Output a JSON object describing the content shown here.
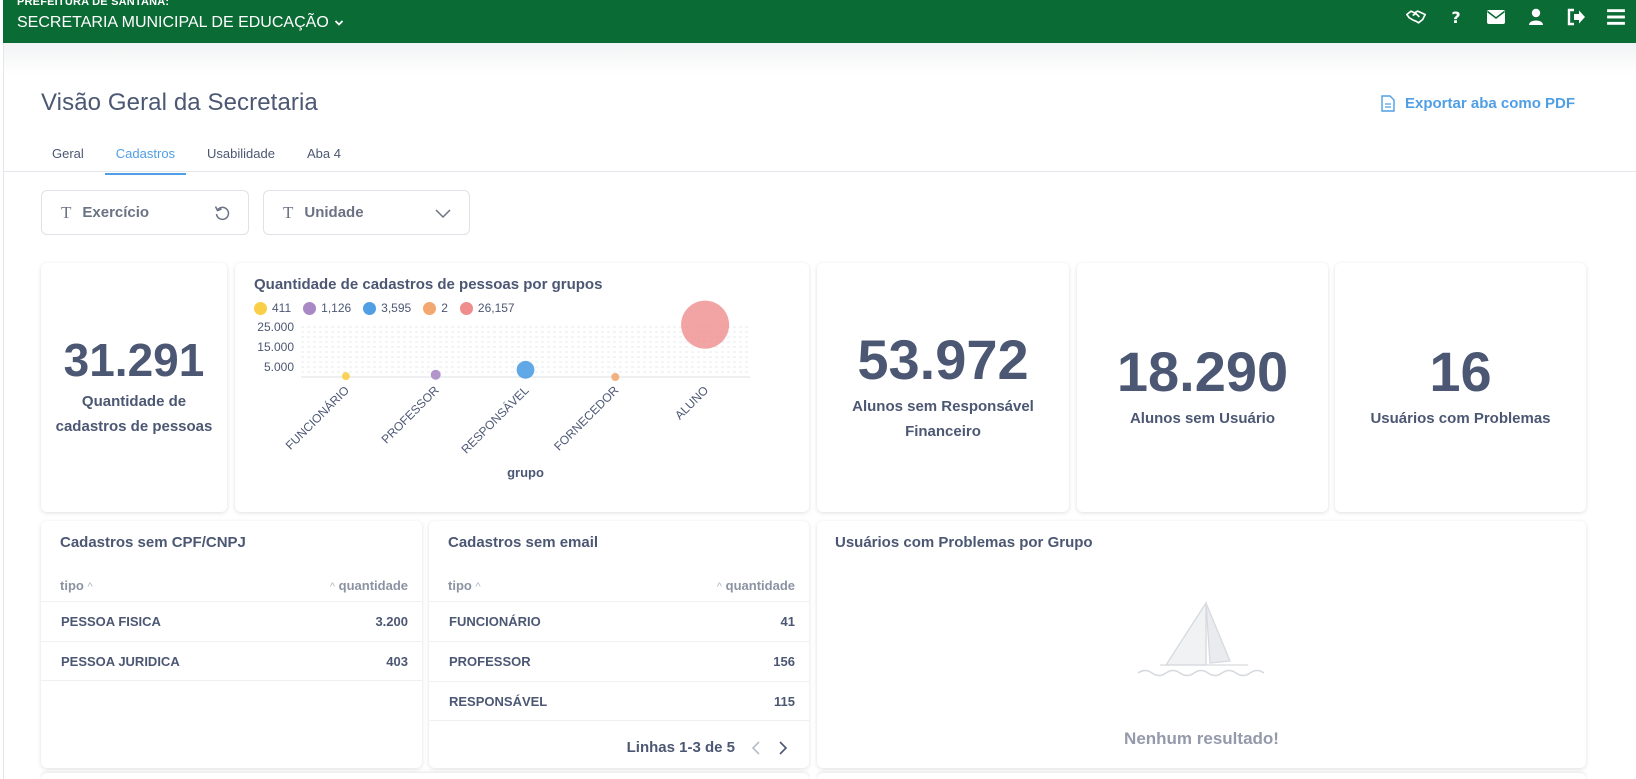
{
  "header": {
    "org": "PREFEITURA DE SANTANA:",
    "department": "SECRETARIA MUNICIPAL DE EDUCAÇÃO",
    "icons": [
      "handshake-icon",
      "help-icon",
      "mail-icon",
      "user-icon",
      "logout-icon",
      "menu-icon"
    ],
    "background_color": "#0b6b35"
  },
  "page": {
    "title": "Visão Geral da Secretaria",
    "export_label": "Exportar aba como PDF",
    "tabs": [
      {
        "label": "Geral",
        "active": false
      },
      {
        "label": "Cadastros",
        "active": true
      },
      {
        "label": "Usabilidade",
        "active": false
      },
      {
        "label": "Aba 4",
        "active": false
      }
    ],
    "accent_color": "#509ee3"
  },
  "filters": [
    {
      "label": "Exercício",
      "icon": "reset-icon"
    },
    {
      "label": "Unidade",
      "icon": "chevron-down-icon"
    }
  ],
  "kpis": {
    "people": {
      "value": "31.291",
      "label": "Quantidade de cadastros de pessoas"
    },
    "no_guardian": {
      "value": "53.972",
      "label": "Alunos sem Responsável Financeiro"
    },
    "no_user": {
      "value": "18.290",
      "label": "Alunos sem Usuário"
    },
    "problem_users": {
      "value": "16",
      "label": "Usuários com Problemas"
    }
  },
  "chart_data": {
    "type": "scatter",
    "title": "Quantidade de cadastros de pessoas por grupos",
    "xlabel": "grupo",
    "ylabel": "",
    "categories": [
      "FUNCIONÁRIO",
      "PROFESSOR",
      "RESPONSÁVEL",
      "FORNECEDOR",
      "ALUNO"
    ],
    "values": [
      411,
      1126,
      3595,
      2,
      26157
    ],
    "legend": [
      "411",
      "1,126",
      "3,595",
      "2",
      "26,157"
    ],
    "colors": [
      "#f9cf48",
      "#a989c5",
      "#509ee3",
      "#f2a86f",
      "#ef8c8c"
    ],
    "y_ticks": [
      "5.000",
      "15.000",
      "25.000"
    ],
    "y_tick_values": [
      5000,
      15000,
      25000
    ],
    "ylim": [
      0,
      27000
    ],
    "grid": true,
    "legend_position": "top-left"
  },
  "table_cpf": {
    "title": "Cadastros sem CPF/CNPJ",
    "col_tipo": "tipo",
    "col_quantidade": "quantidade",
    "rows": [
      {
        "tipo": "PESSOA FISICA",
        "quantidade": "3.200"
      },
      {
        "tipo": "PESSOA JURIDICA",
        "quantidade": "403"
      }
    ]
  },
  "table_email": {
    "title": "Cadastros sem email",
    "col_tipo": "tipo",
    "col_quantidade": "quantidade",
    "rows": [
      {
        "tipo": "FUNCIONÁRIO",
        "quantidade": "41"
      },
      {
        "tipo": "PROFESSOR",
        "quantidade": "156"
      },
      {
        "tipo": "RESPONSÁVEL",
        "quantidade": "115"
      }
    ],
    "pagination": "Linhas 1-3 de 5"
  },
  "problems_by_group": {
    "title": "Usuários com Problemas por Grupo",
    "empty_message": "Nenhum resultado!"
  }
}
